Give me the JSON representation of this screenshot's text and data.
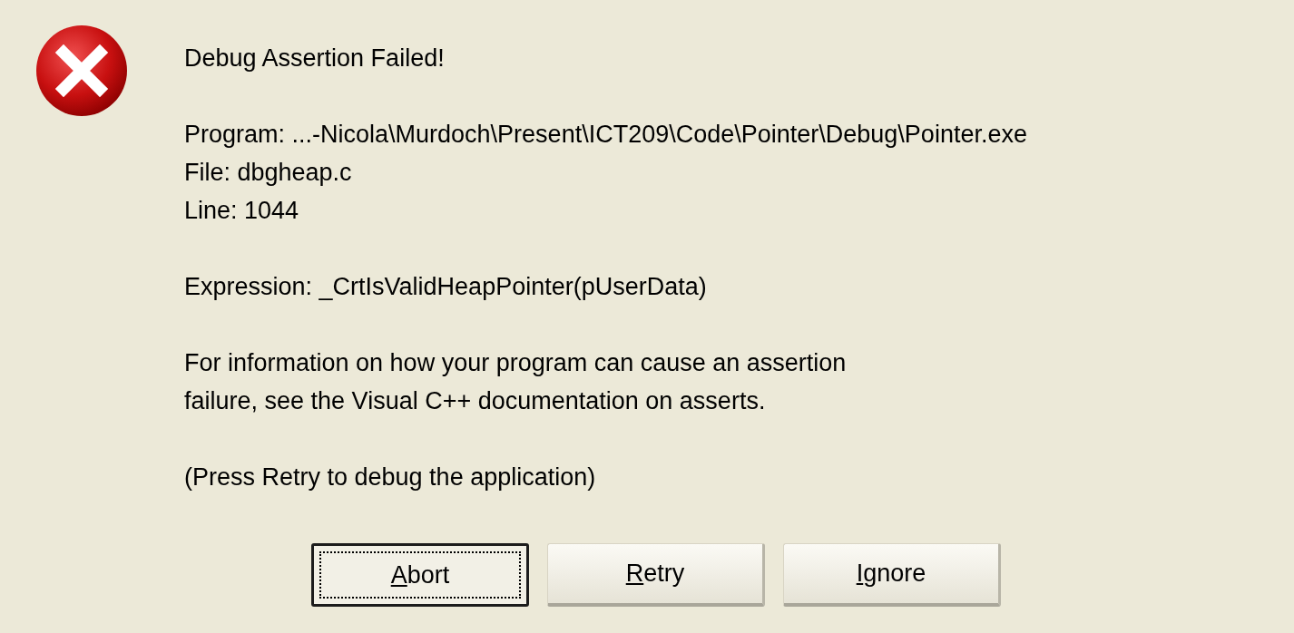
{
  "dialog": {
    "icon": {
      "kind": "error"
    },
    "paragraphs": [
      [
        "Debug Assertion Failed!"
      ],
      [
        "Program: ...-Nicola\\Murdoch\\Present\\ICT209\\Code\\Pointer\\Debug\\Pointer.exe",
        "File: dbgheap.c",
        "Line: 1044"
      ],
      [
        "Expression: _CrtIsValidHeapPointer(pUserData)"
      ],
      [
        "For information on how your program can cause an assertion",
        "failure, see the Visual C++ documentation on asserts."
      ],
      [
        "(Press Retry to debug the application)"
      ]
    ],
    "buttons": [
      {
        "mnemonic": "A",
        "label_rest": "bort",
        "default": true
      },
      {
        "mnemonic": "R",
        "label_rest": "etry",
        "default": false
      },
      {
        "mnemonic": "I",
        "label_rest": "gnore",
        "default": false
      }
    ]
  }
}
